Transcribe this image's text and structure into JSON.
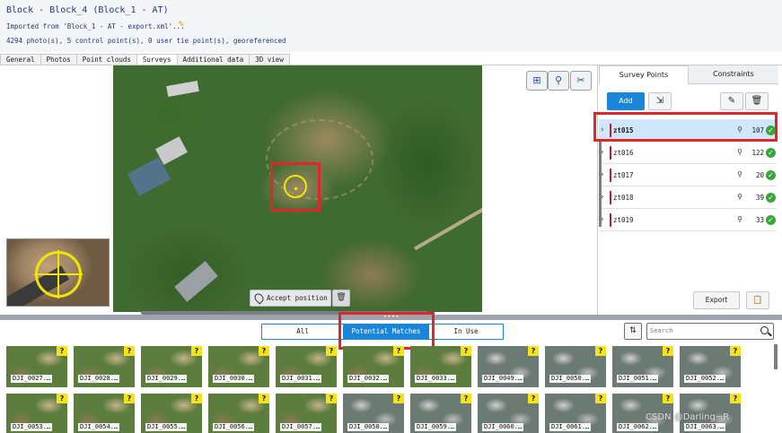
{
  "header": {
    "title": "Block - Block_4 (Block_1 - AT)",
    "imported": "Imported from 'Block_1 - AT - export.xml'...",
    "summary": "4294 photo(s), 5 control point(s), 0 user tie point(s), georeferenced"
  },
  "tabs": [
    "General",
    "Photos",
    "Point clouds",
    "Surveys",
    "Additional data",
    "3D view"
  ],
  "active_tab": "Surveys",
  "viewer": {
    "accept_label": "Accept position",
    "delete_icon": "trash-icon"
  },
  "survey_panel": {
    "tab_survey_points": "Survey Points",
    "tab_constraints": "Constraints",
    "add_label": "Add",
    "export_label": "Export",
    "points": [
      {
        "name": "zt015",
        "count": "107",
        "selected": true
      },
      {
        "name": "zt016",
        "count": "122"
      },
      {
        "name": "zt017",
        "count": "20"
      },
      {
        "name": "zt018",
        "count": "39"
      },
      {
        "name": "zt019",
        "count": "33"
      }
    ]
  },
  "filters": {
    "all": "All",
    "potential": "Potential Matches",
    "in_use": "In Use",
    "active": "Potential Matches"
  },
  "search": {
    "placeholder": "Search"
  },
  "thumbnails_row1": [
    "DJI_0027.…",
    "DJI_0028.…",
    "DJI_0029.…",
    "DJI_0030.…",
    "DJI_0031.…",
    "DJI_0032.…",
    "DJI_0033.…",
    "DJI_0049.…",
    "DJI_0050.…",
    "DJI_0051.…",
    "DJI_0052.…"
  ],
  "thumbnails_row2": [
    "DJI_0053.…",
    "DJI_0054.…",
    "DJI_0055.…",
    "DJI_0056.…",
    "DJI_0057.…",
    "DJI_0058.…",
    "DJI_0059.…",
    "DJI_0060.…",
    "DJI_0061.…",
    "DJI_0062.…",
    "DJI_0063.…"
  ],
  "watermark": "CSDN @Darling~R",
  "colors": {
    "accent": "#1a86d9",
    "highlight": "#e1262b",
    "marker": "#f2e600",
    "ok": "#3aa63a"
  }
}
